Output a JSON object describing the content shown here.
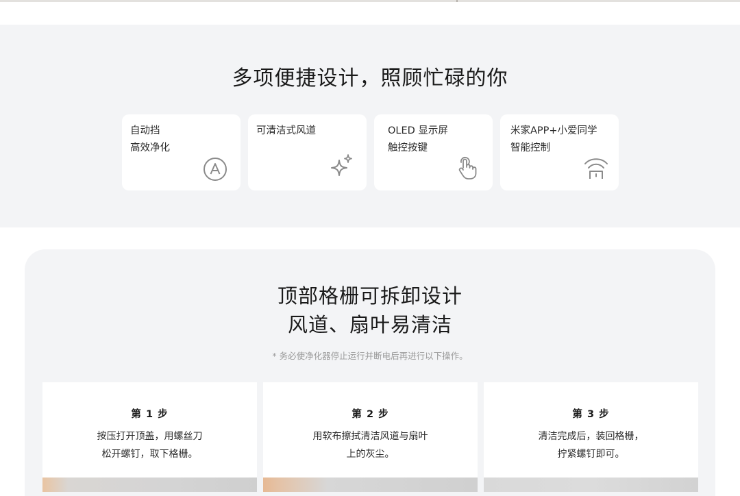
{
  "features": {
    "title": "多项便捷设计，照顾忙碌的你",
    "cards": [
      {
        "line1": "自动挡",
        "line2": "高效净化",
        "icon": "auto-mode-icon"
      },
      {
        "line1": "可清洁式风道",
        "line2": "",
        "icon": "sparkle-icon"
      },
      {
        "line1": "OLED 显示屏",
        "line2": "触控按键",
        "icon": "touch-icon"
      },
      {
        "line1": "米家APP+小爱同学",
        "line2": "智能控制",
        "icon": "wifi-device-icon"
      }
    ]
  },
  "cleaning": {
    "title_line1": "顶部格栅可拆卸设计",
    "title_line2": "风道、扇叶易清洁",
    "note": "* 务必使净化器停止运行并断电后再进行以下操作。",
    "steps": [
      {
        "title": "第 1 步",
        "desc_line1": "按压打开顶盖，用螺丝刀",
        "desc_line2": "松开螺钉，取下格栅。"
      },
      {
        "title": "第 2 步",
        "desc_line1": "用软布擦拭清洁风道与扇叶",
        "desc_line2": "上的灰尘。"
      },
      {
        "title": "第 3 步",
        "desc_line1": "清洁完成后，装回格栅，",
        "desc_line2": "拧紧螺钉即可。"
      }
    ]
  },
  "colors": {
    "section_bg": "#f3f4f6",
    "card_bg": "#ffffff",
    "icon_gray": "#8a8a8a"
  }
}
